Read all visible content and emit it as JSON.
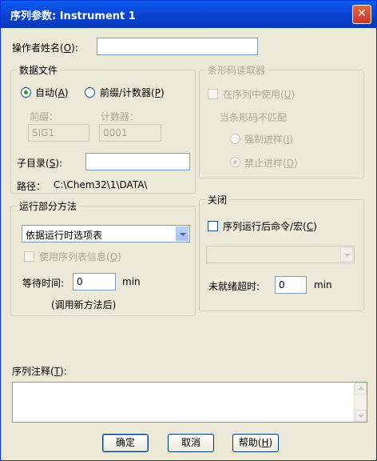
{
  "window": {
    "title": "序列参数: Instrument 1",
    "close_glyph": "✕"
  },
  "operator": {
    "label_pre": "操作者姓名(",
    "label_key": "O",
    "label_post": "):",
    "value": ""
  },
  "data_file": {
    "group_title": "数据文件",
    "auto_label_pre": "自动(",
    "auto_key": "A",
    "auto_label_post": ")",
    "prefix_counter_pre": "前缀/计数器(",
    "prefix_counter_key": "P",
    "prefix_counter_post": ")",
    "prefix_label": "前缀：",
    "prefix_value": "SIG1",
    "counter_label": "计数器：",
    "counter_value": "0001",
    "subdir_pre": "子目录(",
    "subdir_key": "S",
    "subdir_post": "):",
    "subdir_value": "",
    "path_label": "路径：",
    "path_value": "C:\\Chem32\\1\\DATA\\"
  },
  "barcode": {
    "group_title": "条形码读取器",
    "use_in_sequence_pre": "在序列中使用(",
    "use_in_sequence_key": "U",
    "use_in_sequence_post": ")",
    "mismatch_label": "当条形码不匹配",
    "force_pre": "强制进样(",
    "force_key": "I",
    "force_post": ")",
    "forbid_pre": "禁止进样(",
    "forbid_key": "D",
    "forbid_post": ")"
  },
  "run_method": {
    "group_title": "运行部分方法",
    "selected": "依据运行时选项表",
    "use_seq_info_pre": "使用序列表信息(",
    "use_seq_info_key": "Q",
    "use_seq_info_post": ")",
    "wait_label": "等待时间:",
    "wait_value": "0",
    "wait_unit": "min",
    "wait_note": "(调用新方法后)"
  },
  "shutdown": {
    "group_title": "关闭",
    "post_cmd_pre": "序列运行后命令/宏(",
    "post_cmd_key": "C",
    "post_cmd_post": ")",
    "post_cmd_value": "",
    "not_ready_label": "未就绪超时:",
    "not_ready_value": "0",
    "not_ready_unit": "min"
  },
  "comment": {
    "label_pre": "序列注释(",
    "label_key": "T",
    "label_post": "):",
    "value": ""
  },
  "buttons": {
    "ok": "确定",
    "cancel": "取消",
    "help_pre": "帮助(",
    "help_key": "H",
    "help_post": ")"
  },
  "colors": {
    "title_bar": "#0a46d6",
    "dialog_bg": "#ece9d8",
    "disabled_text": "#aca899",
    "radio_dot": "#21a121"
  }
}
